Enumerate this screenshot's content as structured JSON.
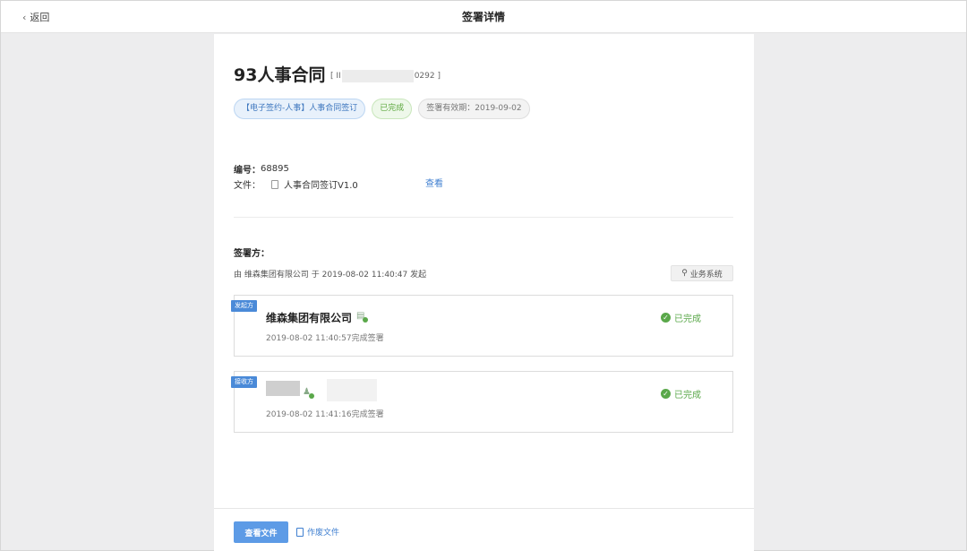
{
  "header": {
    "back_label": "返回",
    "title": "签署详情"
  },
  "document": {
    "title": "93人事合同",
    "id_prefix": "[ II",
    "id_suffix": "0292 ]",
    "tags": {
      "type": "【电子签约-人事】人事合同签订",
      "status": "已完成",
      "validity": "签署有效期：2019-09-02"
    },
    "number_label": "编号：",
    "number_value": "68895",
    "file_label": "文件：",
    "file_name": "人事合同签订V1.0",
    "view_label": "查看"
  },
  "signers": {
    "label": "签署方：",
    "initiated_prefix": "由",
    "initiator": "维森集团有限公司",
    "initiated_at_word": "于",
    "initiated_time": "2019-08-02 11:40:47",
    "initiated_suffix": "发起",
    "biz_button": "业务系统",
    "items": [
      {
        "role": "发起方",
        "name": "维森集团有限公司",
        "time": "2019-08-02 11:40:57完成签署",
        "status": "已完成"
      },
      {
        "role": "接收方",
        "name": "",
        "time": "2019-08-02 11:41:16完成签署",
        "status": "已完成"
      }
    ]
  },
  "footer": {
    "view_file": "查看文件",
    "void_file": "作废文件"
  },
  "colors": {
    "accent": "#5d9be6",
    "success": "#5aa84a",
    "link": "#3f7fd0"
  }
}
